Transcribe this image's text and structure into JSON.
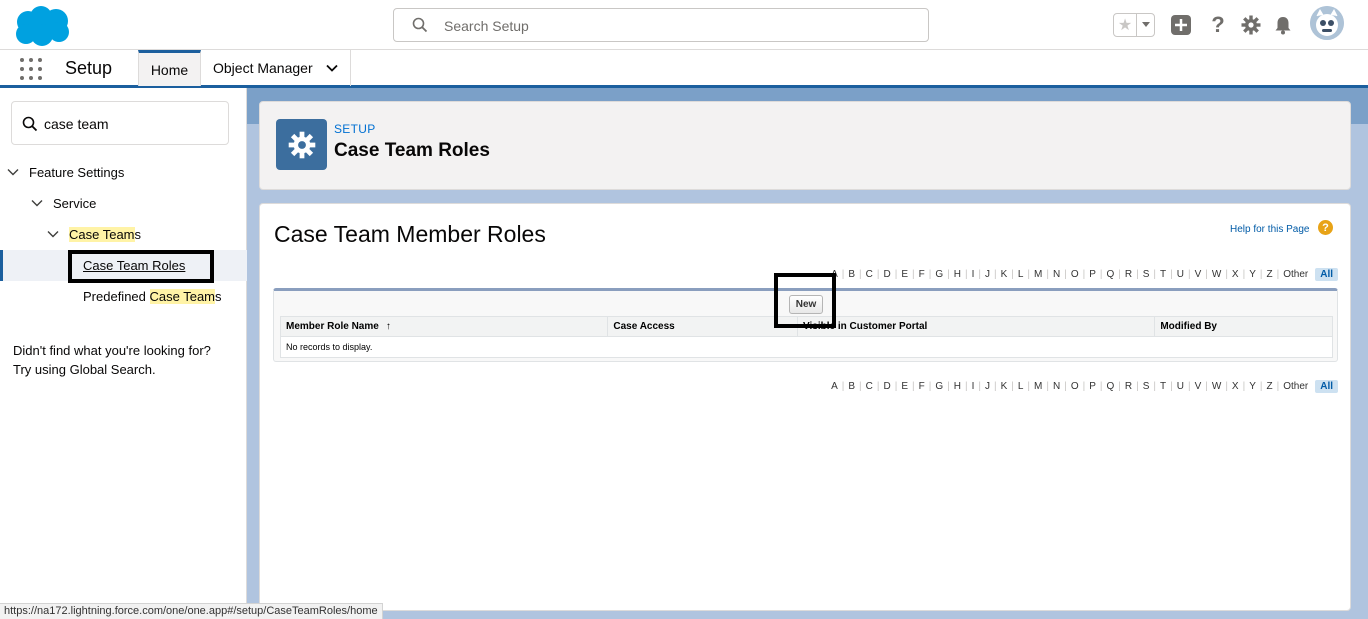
{
  "header": {
    "search_placeholder": "Search Setup",
    "accent": "#1b5f9e",
    "icons": [
      "favorites-star",
      "add",
      "help",
      "gear",
      "bell",
      "avatar"
    ]
  },
  "nav": {
    "app_name": "Setup",
    "tabs": [
      "Home",
      "Object Manager"
    ]
  },
  "sidebar": {
    "quickfind_value": "case team",
    "tree": {
      "feature_settings": "Feature Settings",
      "service": "Service",
      "case_teams_hl": "Case Team",
      "case_teams_rest": "s",
      "case_team_roles": "Case Team Roles",
      "predefined_prefix": "Predefined ",
      "predefined_hl": "Case Team",
      "predefined_rest": "s"
    },
    "not_found_line1": "Didn't find what you're looking for?",
    "not_found_line2": "Try using Global Search."
  },
  "page_header": {
    "label": "SETUP",
    "title": "Case Team Roles"
  },
  "content": {
    "heading": "Case Team Member Roles",
    "help_link": "Help for this Page",
    "help_icon": "?",
    "new_button": "New",
    "columns": [
      "Member Role Name",
      "Case Access",
      "Visible in Customer Portal",
      "Modified By"
    ],
    "sort_indicator": "↑",
    "empty_message": "No records to display.",
    "alpha_other": "Other",
    "alpha_all": "All"
  },
  "status_bar": {
    "url": "https://na172.lightning.force.com/one/one.app#/setup/CaseTeamRoles/home"
  }
}
